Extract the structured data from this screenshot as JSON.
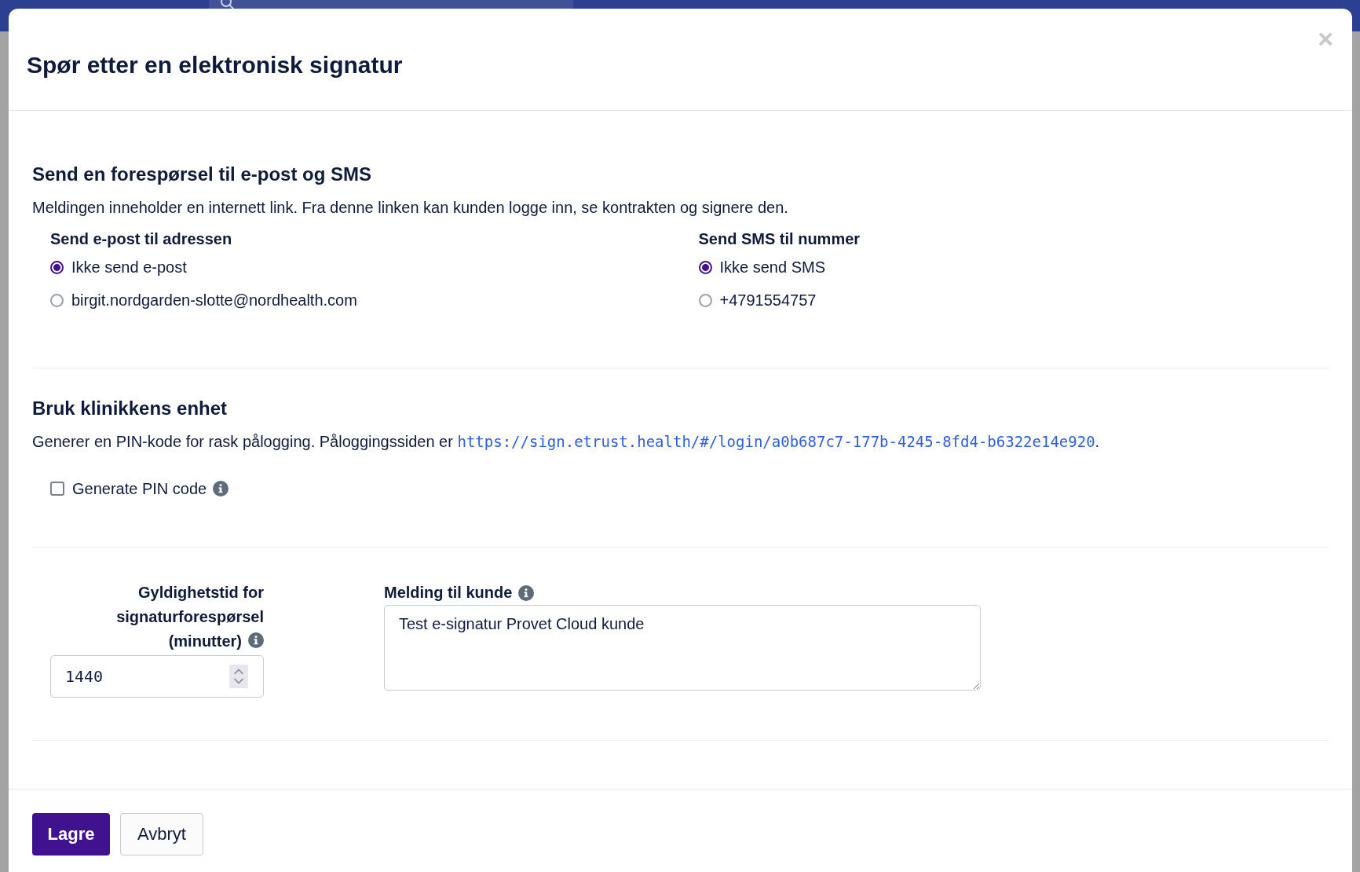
{
  "dialog": {
    "title": "Spør etter en elektronisk signatur",
    "close": "×",
    "request_section": {
      "heading": "Send en forespørsel til e-post og SMS",
      "description": "Meldingen inneholder en internett link. Fra denne linken kan kunden logge inn, se kontrakten og signere den.",
      "groups": [
        {
          "label": "Send e-post til adressen",
          "options": [
            {
              "label": "Ikke send e-post",
              "selected": true
            },
            {
              "label": "birgit.nordgarden-slotte@nordhealth.com",
              "selected": false
            }
          ]
        },
        {
          "label": "Send SMS til nummer",
          "options": [
            {
              "label": "Ikke send SMS",
              "selected": true
            },
            {
              "label": "+4791554757",
              "selected": false
            }
          ]
        }
      ]
    },
    "device_section": {
      "heading": "Bruk klinikkens enhet",
      "description": "Generer en PIN-kode for rask pålogging. Påloggingssiden er ",
      "link": "https://sign.etrust.health/#/login/a0b687c7-177b-4245-8fd4-b6322e14e920",
      "description_end": ".",
      "checkbox": {
        "label": "Generate PIN code",
        "checked": false
      }
    },
    "validity": {
      "label": "Gyldighetstid for signaturforespørsel (minutter)",
      "value": "1440"
    },
    "message": {
      "label": "Melding til kunde",
      "value": "Test e-signatur Provet Cloud kunde"
    },
    "buttons": [
      {
        "label": "Lagre",
        "kind": "primary"
      },
      {
        "label": "Avbryt",
        "kind": "secondary"
      }
    ]
  }
}
